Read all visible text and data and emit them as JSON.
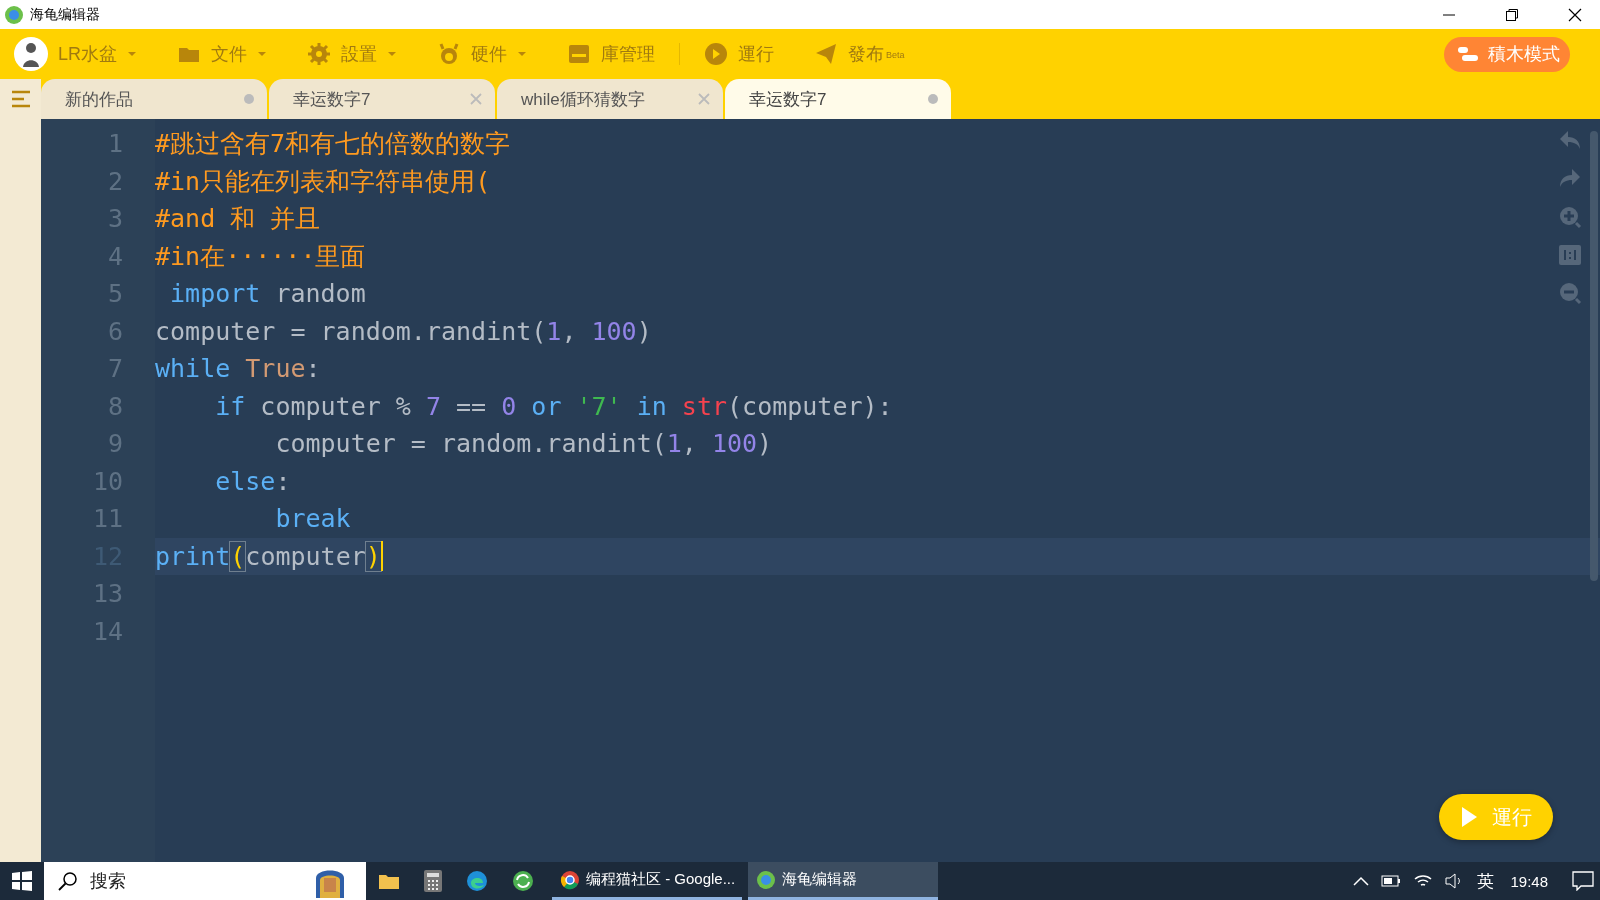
{
  "window": {
    "title": "海龟编辑器"
  },
  "toolbar": {
    "user": "LR水盆",
    "menus": [
      {
        "kind": "folder",
        "label": "文件",
        "dropdown": true
      },
      {
        "kind": "gear",
        "label": "設置",
        "dropdown": true
      },
      {
        "kind": "robot",
        "label": "硬件",
        "dropdown": true
      },
      {
        "kind": "box",
        "label": "庫管理",
        "dropdown": false
      },
      {
        "kind": "play",
        "label": "運行",
        "dropdown": false
      },
      {
        "kind": "send",
        "label": "發布",
        "badge": "Beta",
        "dropdown": false
      }
    ],
    "block_mode_button": "積木模式"
  },
  "tabs": [
    {
      "label": "新的作品",
      "selected": false,
      "modified": true
    },
    {
      "label": "幸运数字7",
      "selected": false,
      "modified": false
    },
    {
      "label": "while循环猜数字",
      "selected": false,
      "modified": false
    },
    {
      "label": "幸运数字7",
      "selected": true,
      "modified": true
    }
  ],
  "editor": {
    "lines": [
      {
        "number": "1",
        "current": false,
        "tokens": [
          {
            "kind": "comment",
            "text": "#跳过含有7和有七的倍数的数字"
          }
        ]
      },
      {
        "number": "2",
        "current": false,
        "tokens": [
          {
            "kind": "comment",
            "text": "#in只能在列表和字符串使用("
          }
        ]
      },
      {
        "number": "3",
        "current": false,
        "tokens": [
          {
            "kind": "comment",
            "text": "#and 和 并且"
          }
        ]
      },
      {
        "number": "4",
        "current": false,
        "tokens": [
          {
            "kind": "comment",
            "text": "#in在······里面"
          }
        ]
      },
      {
        "number": "5",
        "current": false,
        "tokens": [
          {
            "kind": "keyword",
            "text": " import"
          },
          {
            "kind": "plain",
            "text": " random"
          }
        ]
      },
      {
        "number": "6",
        "current": false,
        "tokens": [
          {
            "kind": "plain",
            "text": "computer = random.randint("
          },
          {
            "kind": "number",
            "text": "1"
          },
          {
            "kind": "plain",
            "text": ", "
          },
          {
            "kind": "number",
            "text": "100"
          },
          {
            "kind": "plain",
            "text": ")"
          }
        ]
      },
      {
        "number": "7",
        "current": false,
        "tokens": [
          {
            "kind": "keyword",
            "text": "while"
          },
          {
            "kind": "constant",
            "text": " True"
          },
          {
            "kind": "plain",
            "text": ":"
          }
        ]
      },
      {
        "number": "8",
        "current": false,
        "tokens": [
          {
            "kind": "keyword",
            "text": "    if"
          },
          {
            "kind": "plain",
            "text": " computer % "
          },
          {
            "kind": "number",
            "text": "7"
          },
          {
            "kind": "plain",
            "text": " == "
          },
          {
            "kind": "number",
            "text": "0"
          },
          {
            "kind": "keyword",
            "text": " or"
          },
          {
            "kind": "string",
            "text": " '7'"
          },
          {
            "kind": "keyword",
            "text": " in"
          },
          {
            "kind": "builtin",
            "text": " str"
          },
          {
            "kind": "plain",
            "text": "(computer):"
          }
        ]
      },
      {
        "number": "9",
        "current": false,
        "tokens": [
          {
            "kind": "plain",
            "text": "        computer = random.randint("
          },
          {
            "kind": "number",
            "text": "1"
          },
          {
            "kind": "plain",
            "text": ", "
          },
          {
            "kind": "number",
            "text": "100"
          },
          {
            "kind": "plain",
            "text": ")"
          }
        ]
      },
      {
        "number": "10",
        "current": false,
        "tokens": [
          {
            "kind": "keyword",
            "text": "    else"
          },
          {
            "kind": "plain",
            "text": ":"
          }
        ]
      },
      {
        "number": "11",
        "current": false,
        "tokens": [
          {
            "kind": "keyword",
            "text": "        break"
          }
        ]
      },
      {
        "number": "12",
        "current": true,
        "tokens": [
          {
            "kind": "keyword",
            "text": "print"
          },
          {
            "kind": "bracket",
            "text": "("
          },
          {
            "kind": "plain",
            "text": "computer"
          },
          {
            "kind": "bracket",
            "text": ")"
          }
        ]
      },
      {
        "number": "13",
        "current": false
      },
      {
        "number": "14",
        "current": false
      }
    ]
  },
  "run_button": "運行",
  "taskbar": {
    "search": {
      "placeholder": "搜索"
    },
    "windows": [
      {
        "kind": "chrome",
        "label": "编程猫社区 - Google...",
        "selected": false
      },
      {
        "kind": "turtle",
        "label": "海龟编辑器",
        "selected": true
      }
    ],
    "ime": "英",
    "time": "19:48"
  }
}
